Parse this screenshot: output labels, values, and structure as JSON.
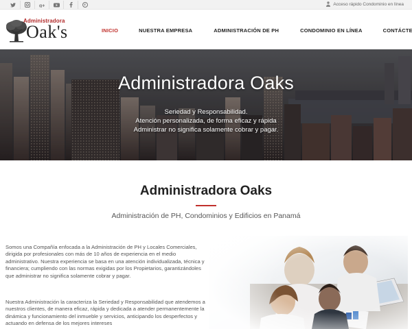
{
  "topbar": {
    "social_icons": [
      "twitter-icon",
      "instagram-icon",
      "google-plus-icon",
      "youtube-icon",
      "facebook-icon",
      "pinterest-icon"
    ],
    "quick_access": "Acceso rápido Condominio en línea"
  },
  "logo": {
    "small": "Administradora",
    "big": "Oak's"
  },
  "nav": {
    "items": [
      {
        "label": "INICIO",
        "active": true
      },
      {
        "label": "NUESTRA EMPRESA",
        "active": false
      },
      {
        "label": "ADMINISTRACIÓN DE PH",
        "active": false
      },
      {
        "label": "CONDOMINIO EN LÍNEA",
        "active": false
      },
      {
        "label": "CONTÁCTENOS",
        "active": false
      }
    ]
  },
  "hero": {
    "title": "Administradora Oaks",
    "lines": [
      "Seriedad y Responsabilidad.",
      "Atención personalizada, de forma eficaz y rápida",
      "Administrar no significa solamente cobrar y pagar."
    ]
  },
  "main": {
    "title": "Administradora Oaks",
    "subtitle": "Administración de PH, Condominios y Edificios en Panamá",
    "paragraph1": "Somos una Compañía enfocada a la Administración de PH y Locales Comerciales, dirigida por profesionales con más de 10 años de experiencia en el medio administrativo. Nuestra experiencia se basa en una atención individualizada, técnica y financiera; cumpliendo con las normas exigidas por los Propietarios, garantizándoles que administrar no significa solamente cobrar y pagar.",
    "paragraph2": "Nuestra Administración la caracteriza la Seriedad y Responsabilidad que atendemos a nuestros clientes, de manera eficaz, rápida y dedicada a atender permanentemente la dinámica y funcionamiento del inmueble y servicios, anticipando los desperfectos y actuando en defensa de los mejores intereses"
  },
  "colors": {
    "accent": "#c0302c",
    "text": "#222222",
    "topbar": "#f2f2f2"
  }
}
